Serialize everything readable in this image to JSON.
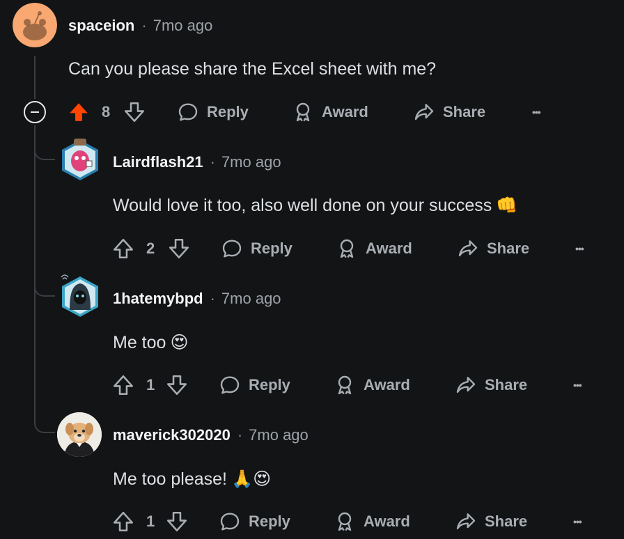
{
  "collapse_label": "collapse-thread",
  "actions": {
    "reply": "Reply",
    "award": "Award",
    "share": "Share",
    "more": "•••"
  },
  "colors": {
    "background": "#131416",
    "upvote_active": "#ff4500",
    "muted": "#a9aeb3",
    "thread_line": "#3a3d41"
  },
  "comments": [
    {
      "username": "spaceion",
      "time": "7mo ago",
      "text": "Can you please share the Excel sheet with me?",
      "votes": "8",
      "upvoted": true,
      "avatar": "snoo-orange-avatar"
    },
    {
      "username": "Lairdflash21",
      "time": "7mo ago",
      "text": "Would love it too, also well done on your success",
      "emoji": "👊",
      "votes": "2",
      "upvoted": false,
      "avatar": "hexagon-pink-avatar"
    },
    {
      "username": "1hatemybpd",
      "time": "7mo ago",
      "text": "Me too",
      "emoji": "😍",
      "votes": "1",
      "upvoted": false,
      "avatar": "hexagon-hooded-avatar"
    },
    {
      "username": "maverick302020",
      "time": "7mo ago",
      "text": "Me too please!",
      "emoji": "🙏😍",
      "votes": "1",
      "upvoted": false,
      "avatar": "dog-photo-avatar"
    }
  ]
}
